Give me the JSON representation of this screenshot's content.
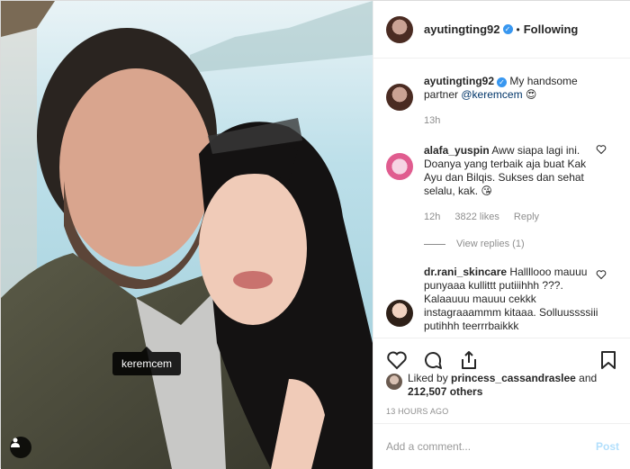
{
  "photo": {
    "tag_label": "keremcem"
  },
  "header": {
    "username": "ayutingting92",
    "separator": "•",
    "follow_status": "Following"
  },
  "caption": {
    "username": "ayutingting92",
    "text": "My handsome partner",
    "mention": "@keremcem",
    "emoji": "😍",
    "time": "13h"
  },
  "comments": [
    {
      "username": "alafa_yuspin",
      "text": "Aww siapa lagi ini. Doanya yang terbaik aja buat Kak Ayu dan Bilqis. Sukses dan sehat selalu, kak. 😘",
      "time": "12h",
      "likes": "3822 likes",
      "reply_label": "Reply",
      "view_replies": "View replies (1)"
    },
    {
      "username": "dr.rani_skincare",
      "text": "Hallllooo mauuu punyaaa kullittt putiiihhh ???. Kalaauuu mauuu cekkk instagraaammm kitaaa. Solluussssiii putihhh teerrrbaikkk"
    }
  ],
  "liked_by": {
    "prefix": "Liked by",
    "user": "princess_cassandraslee",
    "and": "and",
    "count": "212,507 others"
  },
  "date": "13 HOURS AGO",
  "comment_box": {
    "placeholder": "Add a comment...",
    "post_label": "Post"
  },
  "colors": {
    "accent": "#3897f0",
    "post_disabled": "#b2dffc",
    "muted": "#8e8e8e"
  }
}
